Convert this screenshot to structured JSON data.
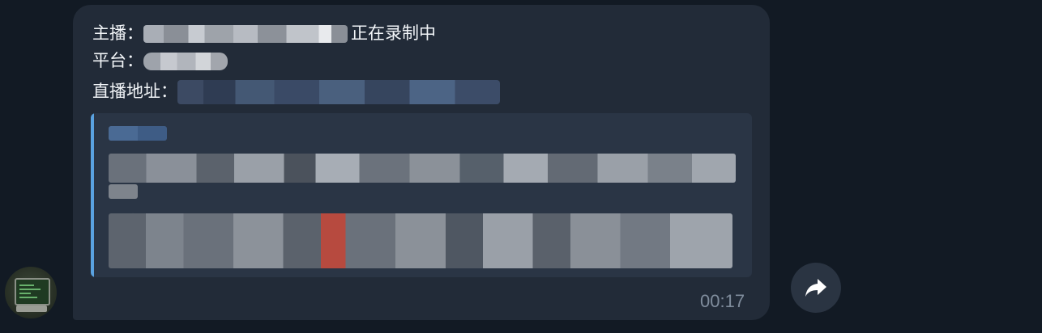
{
  "message": {
    "streamer_label": "主播：",
    "streamer_name_redacted": "██████████",
    "recording_status": "正在录制中",
    "platform_label": "平台：",
    "platform_redacted": "████",
    "url_label": "直播地址：",
    "url_redacted": "█████████████████",
    "preview_visible_text": "抖音",
    "timestamp": "00:17"
  },
  "icons": {
    "forward": "forward-arrow-icon",
    "avatar": "computer-terminal-avatar"
  },
  "colors": {
    "background": "#121a24",
    "bubble": "#222b38",
    "preview_bg": "#2a3545",
    "accent": "#5aa2e0",
    "time": "#7f8c9c"
  }
}
